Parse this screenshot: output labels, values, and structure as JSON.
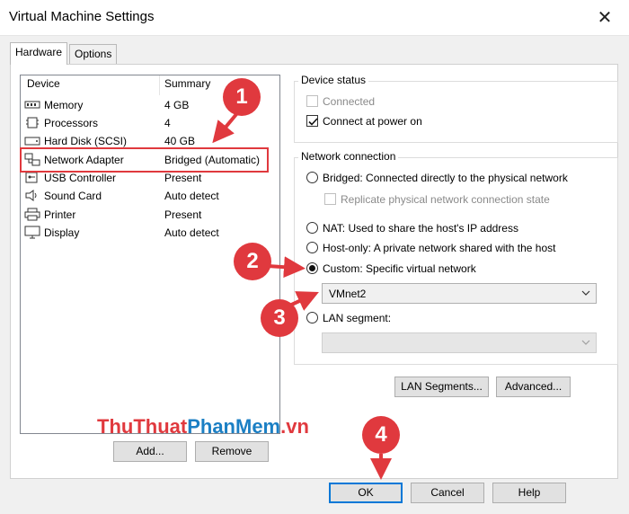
{
  "window": {
    "title": "Virtual Machine Settings",
    "close_glyph": "✕"
  },
  "tabs": [
    {
      "label": "Hardware"
    },
    {
      "label": "Options"
    }
  ],
  "device_list": {
    "headers": {
      "device": "Device",
      "summary": "Summary"
    },
    "rows": [
      {
        "name": "Memory",
        "summary": "4 GB",
        "icon": "memory-icon"
      },
      {
        "name": "Processors",
        "summary": "4",
        "icon": "processor-icon"
      },
      {
        "name": "Hard Disk (SCSI)",
        "summary": "40 GB",
        "icon": "hard-disk-icon"
      },
      {
        "name": "Network Adapter",
        "summary": "Bridged (Automatic)",
        "icon": "network-adapter-icon"
      },
      {
        "name": "USB Controller",
        "summary": "Present",
        "icon": "usb-icon"
      },
      {
        "name": "Sound Card",
        "summary": "Auto detect",
        "icon": "speaker-icon"
      },
      {
        "name": "Printer",
        "summary": "Present",
        "icon": "printer-icon"
      },
      {
        "name": "Display",
        "summary": "Auto detect",
        "icon": "display-icon"
      }
    ],
    "add_label": "Add...",
    "remove_label": "Remove"
  },
  "device_status": {
    "title": "Device status",
    "connected": "Connected",
    "connect_power_on": "Connect at power on"
  },
  "network_connection": {
    "title": "Network connection",
    "bridged": "Bridged: Connected directly to the physical network",
    "replicate": "Replicate physical network connection state",
    "nat": "NAT: Used to share the host's IP address",
    "host_only": "Host-only: A private network shared with the host",
    "custom": "Custom: Specific virtual network",
    "custom_value": "VMnet2",
    "lan_segment": "LAN segment:",
    "lan_segments_button": "LAN Segments...",
    "advanced_button": "Advanced..."
  },
  "footer": {
    "ok": "OK",
    "cancel": "Cancel",
    "help": "Help"
  },
  "annotations": {
    "b1": "1",
    "b2": "2",
    "b3": "3",
    "b4": "4"
  },
  "watermark": {
    "part1": "ThuThuat",
    "part2": "PhanMem",
    "part3": ".vn"
  },
  "colors": {
    "accent": "#0078d7",
    "annotation": "#e0393e",
    "watermark_red": "#e0393e",
    "watermark_blue": "#1b7fc4"
  }
}
